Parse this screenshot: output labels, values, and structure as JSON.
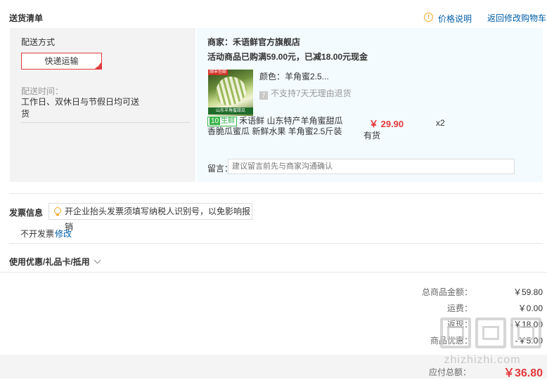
{
  "header": {
    "title": "送货清单",
    "price_info_link": "价格说明",
    "back_to_cart_link": "返回修改购物车"
  },
  "delivery": {
    "method_label": "配送方式",
    "method_button": "快递运输",
    "time_label": "配送时间：",
    "time_value": "工作日、双休日与节假日均可送货"
  },
  "shop": {
    "merchant": "商家：禾语鲜官方旗舰店",
    "promo": "活动商品已购满59.00元，已减18.00元现金"
  },
  "product": {
    "image_tag": "顺丰包邮",
    "image_banner": "山东羊角蜜甜瓜",
    "color_text": "颜色：羊角蜜2.5...",
    "no_return_icon": "7",
    "no_return_text": "不支持7天无理由退货",
    "fresh_badge_dot": "10",
    "fresh_badge": "生鲜",
    "title": "禾语鲜 山东特产羊角蜜甜瓜香脆瓜蜜瓜 新鲜水果 羊角蜜2.5斤装",
    "price": "￥ 29.90",
    "stock": "有货",
    "quantity": "x2"
  },
  "note": {
    "label": "留言：",
    "placeholder": "建议留言前先与商家沟通确认"
  },
  "invoice": {
    "label": "发票信息",
    "tip": "开企业抬头发票须填写纳税人识别号，以免影响报销",
    "status": "不开发票",
    "edit_link": "修改"
  },
  "coupon": {
    "label": "使用优惠/礼品卡/抵用"
  },
  "summary": {
    "rows": [
      {
        "label": "总商品金额：",
        "value": "￥59.80"
      },
      {
        "label": "运费：",
        "value": "￥0.00"
      },
      {
        "label": "返现：",
        "value": "-￥18.00"
      },
      {
        "label": "商品优惠：",
        "value": "-￥5.00"
      }
    ],
    "total_label": "应付总额：",
    "total_value": "￥36.80"
  },
  "watermark": {
    "text": "zhizhizhi.com"
  },
  "colors": {
    "accent_red": "#e4393c",
    "link_blue": "#005ea7",
    "fresh_green": "#3bb54a",
    "panel_blue": "#f3fbfe",
    "panel_gray": "#f3f3f3"
  }
}
